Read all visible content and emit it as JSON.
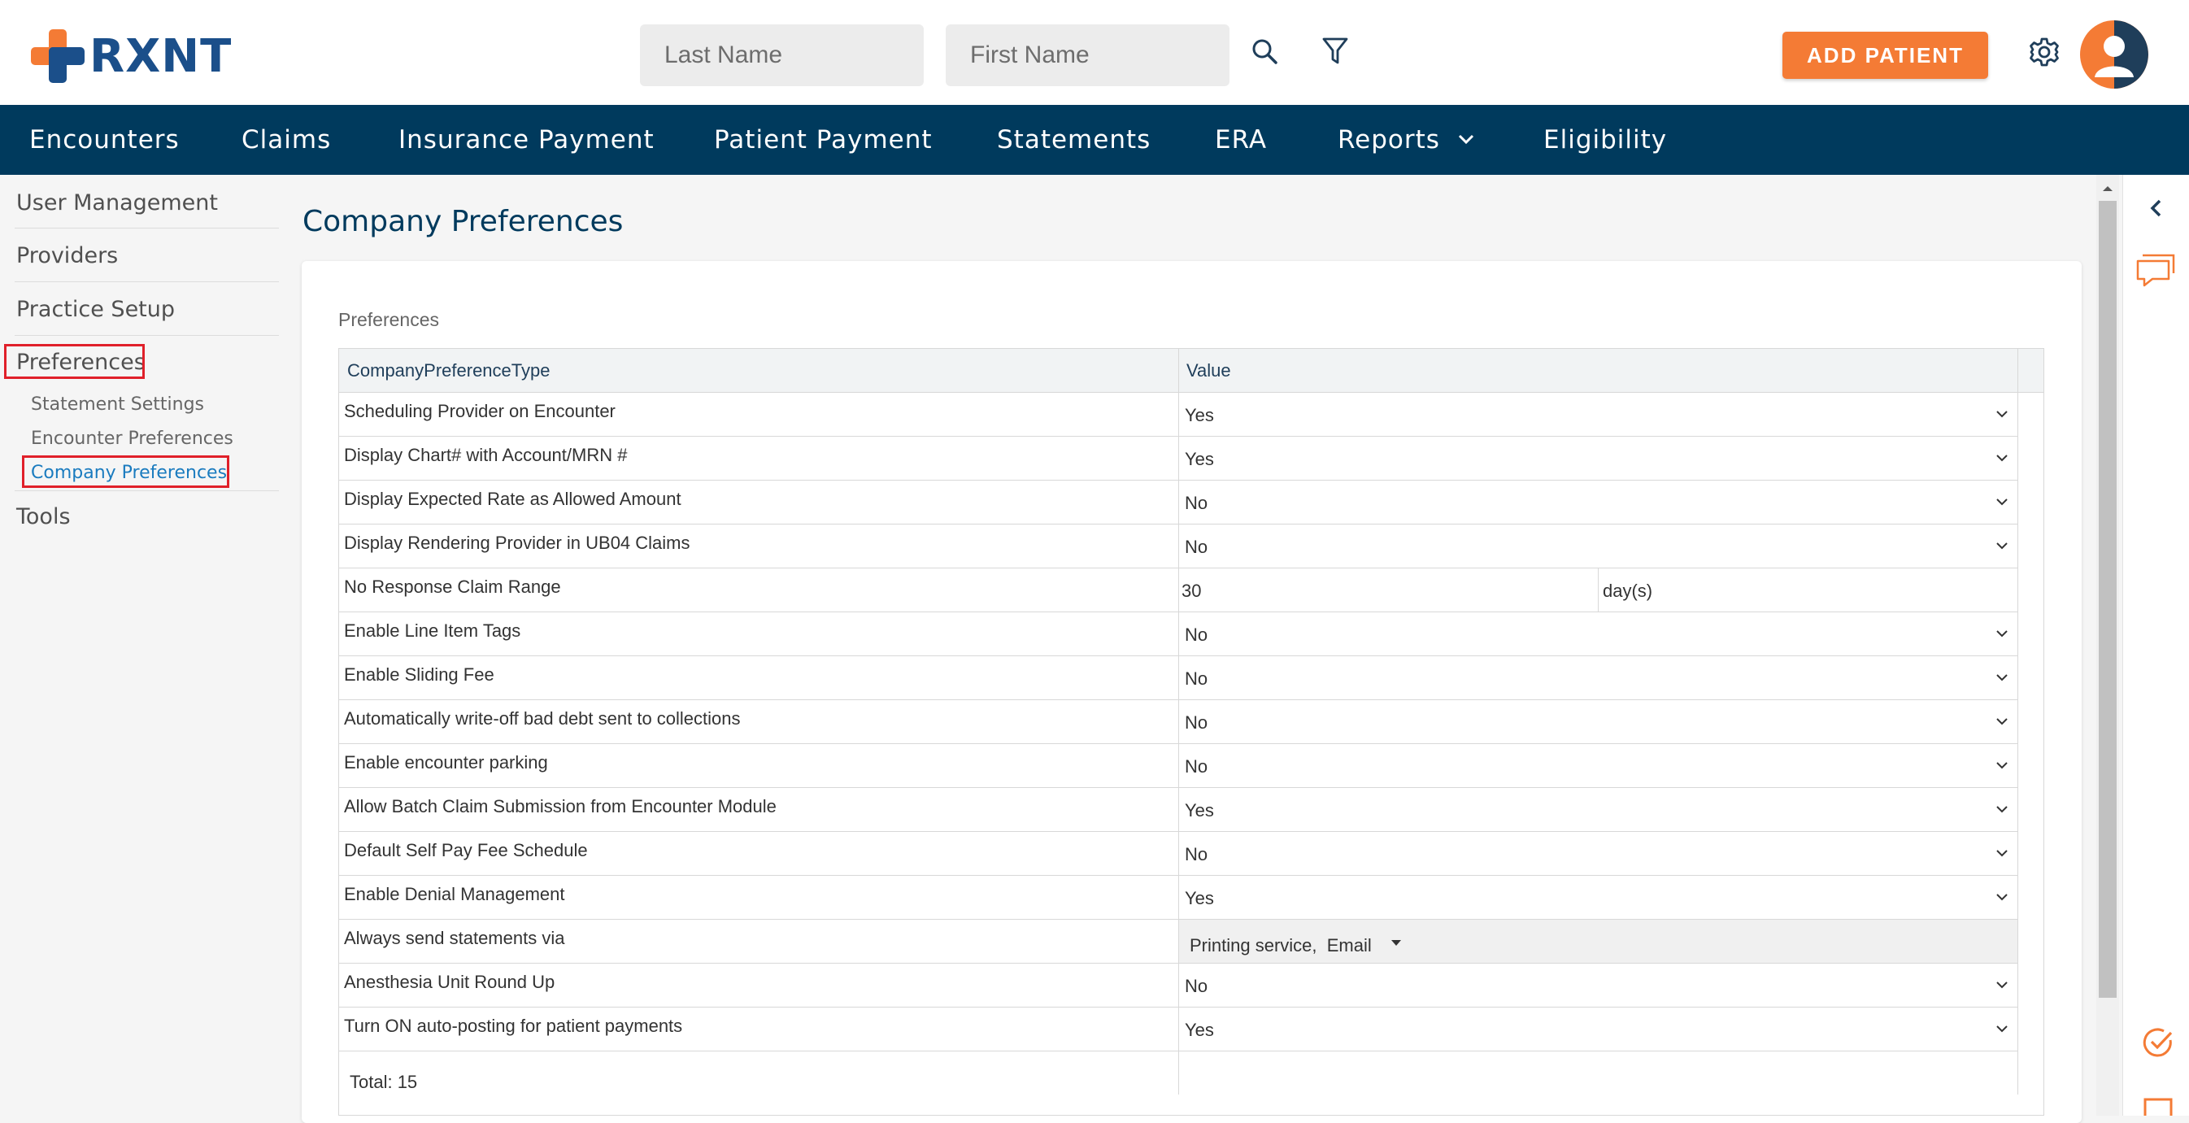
{
  "header": {
    "logo_text": "RXNT",
    "last_name_placeholder": "Last Name",
    "first_name_placeholder": "First Name",
    "add_patient_label": "ADD PATIENT"
  },
  "nav": {
    "items": [
      "Encounters",
      "Claims",
      "Insurance Payment",
      "Patient Payment",
      "Statements",
      "ERA",
      "Reports",
      "Eligibility"
    ]
  },
  "sidebar": {
    "items": [
      "User Management",
      "Providers",
      "Practice Setup",
      "Preferences",
      "Tools"
    ],
    "sub_items": [
      "Statement Settings",
      "Encounter Preferences",
      "Company Preferences"
    ]
  },
  "main": {
    "title": "Company Preferences",
    "section_label": "Preferences",
    "columns": [
      "CompanyPreferenceType",
      "Value"
    ],
    "rows": [
      {
        "label": "Scheduling Provider on Encounter",
        "value": "Yes"
      },
      {
        "label": "Display Chart# with Account/MRN #",
        "value": "Yes"
      },
      {
        "label": "Display Expected Rate as Allowed Amount",
        "value": "No"
      },
      {
        "label": "Display Rendering Provider in UB04 Claims",
        "value": "No"
      },
      {
        "label": "No Response Claim Range",
        "value": "30",
        "unit": "day(s)"
      },
      {
        "label": "Enable Line Item Tags",
        "value": "No"
      },
      {
        "label": "Enable Sliding Fee",
        "value": "No"
      },
      {
        "label": "Automatically write-off bad debt sent to collections",
        "value": "No"
      },
      {
        "label": "Enable encounter parking",
        "value": "No"
      },
      {
        "label": "Allow Batch Claim Submission from Encounter Module",
        "value": "Yes"
      },
      {
        "label": "Default Self Pay Fee Schedule",
        "value": "No"
      },
      {
        "label": "Enable Denial Management",
        "value": "Yes"
      },
      {
        "label": "Always send statements via",
        "value": "Printing service,  Email"
      },
      {
        "label": "Anesthesia Unit Round Up",
        "value": "No"
      },
      {
        "label": "Turn ON auto-posting for patient payments",
        "value": "Yes"
      }
    ],
    "total": "Total: 15"
  },
  "colors": {
    "nav_bg": "#003a5d",
    "accent_orange": "#f47b35",
    "logo_blue": "#1b4f8a",
    "highlight_red": "#e0202a",
    "link_blue": "#1a7bbf"
  }
}
